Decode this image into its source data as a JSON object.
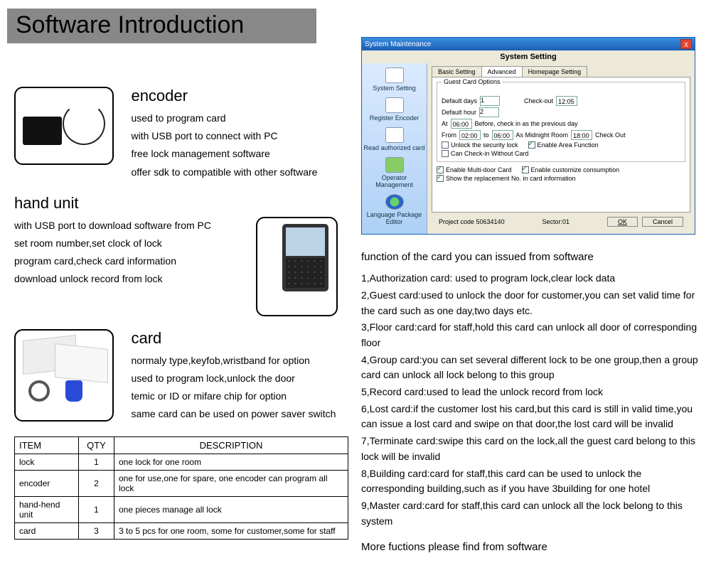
{
  "page_title": "Software Introduction",
  "encoder": {
    "heading": "encoder",
    "l1": "used to program card",
    "l2": "with USB port to connect with PC",
    "l3": "free lock management software",
    "l4": "offer sdk to compatible with other software"
  },
  "hand": {
    "heading": "hand unit",
    "l1": "with USB port to download software from PC",
    "l2": "set room number,set clock of lock",
    "l3": "program card,check card information",
    "l4": "download unlock record from lock"
  },
  "card": {
    "heading": "card",
    "l1": "normaly type,keyfob,wristband for option",
    "l2": "used to program lock,unlock the door",
    "l3": "temic or ID or mifare chip for option",
    "l4": "same card can be used on power saver switch"
  },
  "table": {
    "h_item": "ITEM",
    "h_qty": "QTY",
    "h_desc": "DESCRIPTION",
    "rows": [
      {
        "item": "lock",
        "qty": "1",
        "desc": "one lock for one room"
      },
      {
        "item": "encoder",
        "qty": "2",
        "desc": "one for use,one for spare, one encoder can program all lock"
      },
      {
        "item": "hand-hend unit",
        "qty": "1",
        "desc": "one pieces manage all lock"
      },
      {
        "item": "card",
        "qty": "3",
        "desc": "3 to 5 pcs for one room, some for customer,some for staff"
      }
    ]
  },
  "win": {
    "title": "System Maintenance",
    "heading": "System Setting",
    "side": {
      "s1": "System Setting",
      "s2": "Register Encoder",
      "s3": "Read authorized card",
      "s4": "Operator Management",
      "s5": "Language Package Editor"
    },
    "tabs": {
      "t1": "Basic Setting",
      "t2": "Advanced",
      "t3": "Homepage Setting"
    },
    "group_title": "Guest Card Options",
    "lbl_default_days": "Default days",
    "val_default_days": "1",
    "lbl_checkout": "Check-out",
    "val_checkout": "12:05",
    "lbl_default_hour": "Default hour",
    "val_default_hour": "2",
    "lbl_at": "At",
    "val_at": "06:00",
    "lbl_before": "Before, check in as the previous day",
    "lbl_from": "From",
    "val_from": "02:00",
    "lbl_to": "to",
    "val_to": "06:00",
    "lbl_midnight": "As Midnight Room",
    "val_midnight": "18:00",
    "lbl_checkout2": "Check Out",
    "c1": "Unlock the security lock",
    "c2": "Enable Area Function",
    "c3": "Can Check-in Without Card",
    "c4": "Enable Multi-door Card",
    "c5": "Enable customize consumption",
    "c6": "Show the replacement No. in card information",
    "proj_lbl": "Project code 50634140",
    "sector_lbl": "Sector:01",
    "btn_ok": "OK",
    "btn_cancel": "Cancel"
  },
  "func": {
    "heading": "function of the card you can issued from software",
    "f1": "1,Authorization card: used to program lock,clear lock data",
    "f2": "2,Guest card:used to unlock the door for customer,you can set valid time for the card such as one day,two days etc.",
    "f3": "3,Floor card:card for staff,hold this card can unlock all door of corresponding floor",
    "f4": "4,Group card:you can set several different lock to be one group,then a group card can unlock all lock belong to this group",
    "f5": "5,Record card:used to lead the unlock record from lock",
    "f6": "6,Lost card:if the customer lost his card,but this card is still in valid time,you can issue a lost card and swipe on that door,the lost card will be invalid",
    "f7": "7,Terminate card:swipe this card on the lock,all the guest card belong to this lock will be invalid",
    "f8": "8,Building card:card for staff,this card can be used to unlock the corresponding building,such as if you have 3building for one hotel",
    "f9": "9,Master card:card for staff,this card can unlock all the lock belong to this system",
    "more": "More fuctions please find from software"
  }
}
